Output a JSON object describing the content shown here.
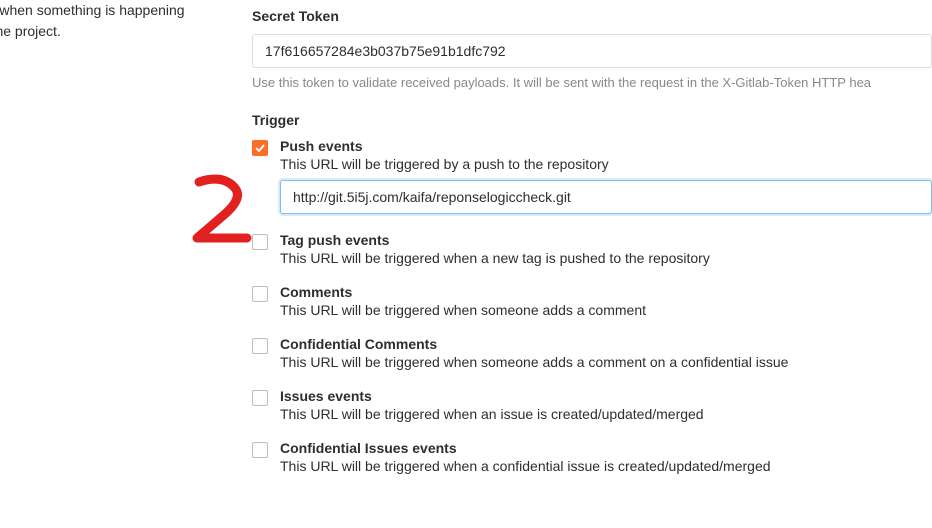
{
  "left": {
    "description_line1": "vents when something is happening",
    "description_line2": "ithin the project."
  },
  "secret": {
    "label": "Secret Token",
    "value": "17f616657284e3b037b75e91b1dfc792",
    "help": "Use this token to validate received payloads. It will be sent with the request in the X-Gitlab-Token HTTP hea"
  },
  "trigger_label": "Trigger",
  "triggers": [
    {
      "title": "Push events",
      "desc": "This URL will be triggered by a push to the repository",
      "checked": true,
      "url_value": "http://git.5i5j.com/kaifa/reponselogiccheck.git"
    },
    {
      "title": "Tag push events",
      "desc": "This URL will be triggered when a new tag is pushed to the repository",
      "checked": false
    },
    {
      "title": "Comments",
      "desc": "This URL will be triggered when someone adds a comment",
      "checked": false
    },
    {
      "title": "Confidential Comments",
      "desc": "This URL will be triggered when someone adds a comment on a confidential issue",
      "checked": false
    },
    {
      "title": "Issues events",
      "desc": "This URL will be triggered when an issue is created/updated/merged",
      "checked": false
    },
    {
      "title": "Confidential Issues events",
      "desc": "This URL will be triggered when a confidential issue is created/updated/merged",
      "checked": false
    }
  ]
}
